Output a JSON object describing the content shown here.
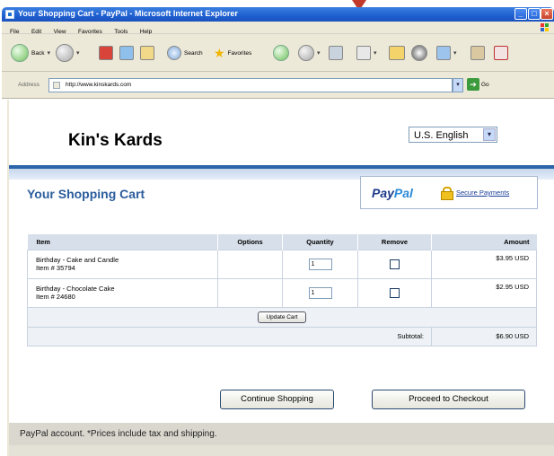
{
  "window": {
    "title": "Your Shopping Cart - PayPal - Microsoft Internet Explorer"
  },
  "menu": [
    "File",
    "Edit",
    "View",
    "Favorites",
    "Tools",
    "Help"
  ],
  "toolbar": {
    "back_label": "Back",
    "search_label": "Search",
    "favorites_label": "Favorites"
  },
  "address": {
    "label": "Address",
    "url": "http://www.kinskards.com",
    "go_label": "Go"
  },
  "store": {
    "name": "Kin's Kards",
    "language": "U.S. English"
  },
  "cart": {
    "title": "Your Shopping Cart",
    "paypal_logo_part1": "Pay",
    "paypal_logo_part2": "Pal",
    "secure_link": "Secure Payments",
    "headers": {
      "item": "Item",
      "options": "Options",
      "quantity": "Quantity",
      "remove": "Remove",
      "amount": "Amount"
    },
    "rows": [
      {
        "name": "Birthday - Cake and Candle",
        "item_no": "Item # 35794",
        "quantity": "1",
        "amount": "$3.95 USD"
      },
      {
        "name": "Birthday - Chocolate Cake",
        "item_no": "Item # 24680",
        "quantity": "1",
        "amount": "$2.95 USD"
      }
    ],
    "update_label": "Update Cart",
    "subtotal_label": "Subtotal:",
    "subtotal_amount": "$6.90 USD"
  },
  "actions": {
    "continue": "Continue Shopping",
    "checkout": "Proceed to Checkout"
  },
  "footer": {
    "text": "PayPal account. *Prices include tax and shipping."
  }
}
